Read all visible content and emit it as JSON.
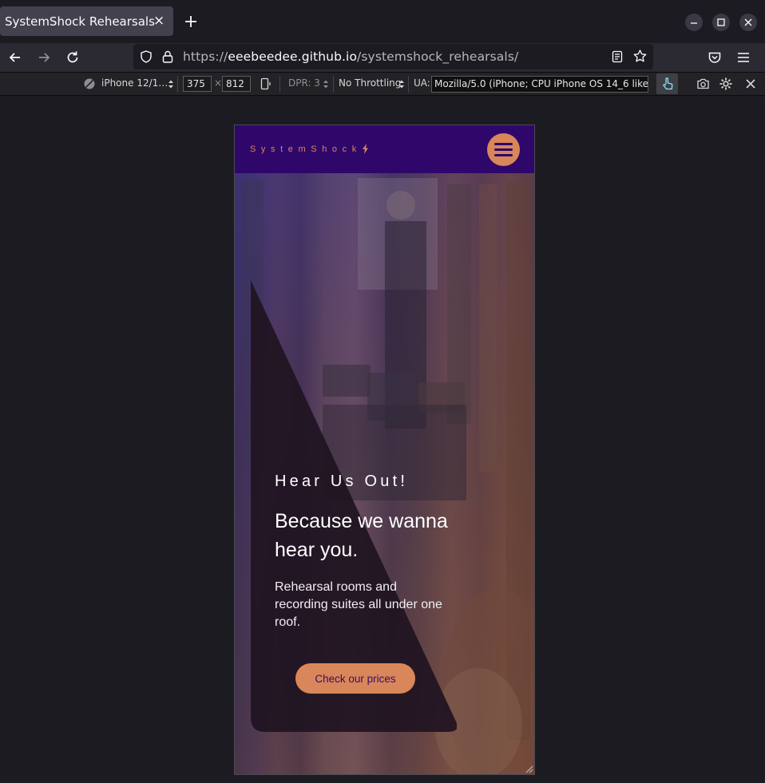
{
  "browser": {
    "tab": {
      "title": "SystemShock Rehearsals",
      "close": "×"
    },
    "new_tab_label": "+",
    "url": {
      "prefix": "https://",
      "host": "eeebeedee.github.io",
      "path": "/systemshock_rehearsals/"
    }
  },
  "devtools": {
    "device": "iPhone 12/1…",
    "width": "375",
    "times": "×",
    "height": "812",
    "dpr": "DPR: 3",
    "throttling": "No Throttling",
    "ua_label": "UA:",
    "ua_value": "Mozilla/5.0 (iPhone; CPU iPhone OS 14_6 like Mac"
  },
  "site": {
    "logo": "SystemShock",
    "hero": {
      "kicker": "Hear Us Out!",
      "title": "Because we wanna hear you.",
      "subtitle": "Rehearsal rooms and recording suites all under one roof.",
      "cta": "Check our prices"
    }
  },
  "colors": {
    "site_nav": "#2f076b",
    "accent": "#d9875a",
    "cta_text": "#3b0a64"
  }
}
